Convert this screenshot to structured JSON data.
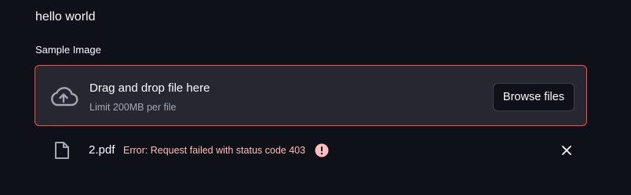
{
  "main": {
    "hello_text": "hello world"
  },
  "uploader": {
    "label": "Sample Image",
    "drop_title": "Drag and drop file here",
    "drop_subtitle": "Limit 200MB per file",
    "browse_label": "Browse files",
    "icon": "cloud-upload-icon"
  },
  "uploaded_file": {
    "name": "2.pdf",
    "error": "Error: Request failed with status code 403",
    "file_icon": "file-icon",
    "error_icon": "error-icon",
    "remove_icon": "close-icon"
  },
  "colors": {
    "background": "#0e1117",
    "dropzone_bg": "#262730",
    "error_border": "#ff4b4b",
    "error_text": "#ffbdbd",
    "muted_text": "#a3a8b8"
  }
}
